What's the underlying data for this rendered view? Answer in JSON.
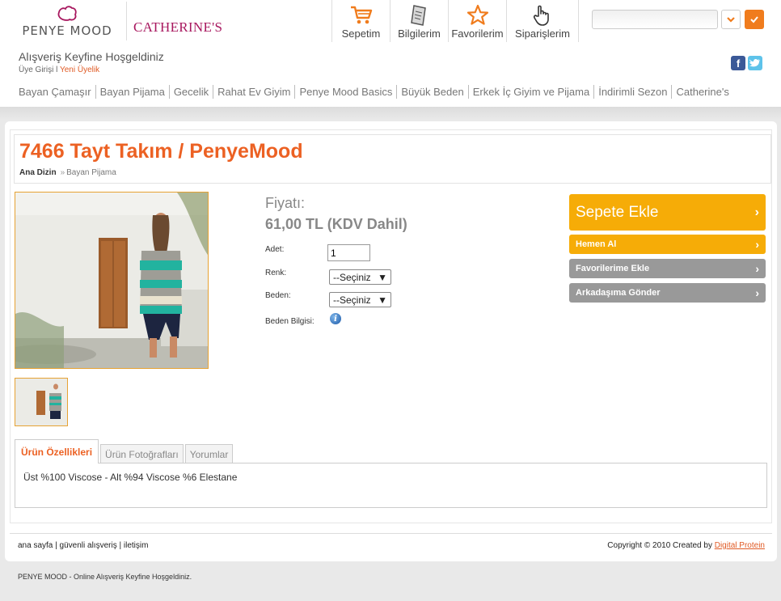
{
  "brand": {
    "primary": "PENYE MOOD",
    "secondary": "CATHERINE'S"
  },
  "topnav": [
    {
      "label": "Sepetim",
      "icon": "cart-icon"
    },
    {
      "label": "Bilgilerim",
      "icon": "document-icon"
    },
    {
      "label": "Favorilerim",
      "icon": "star-icon"
    },
    {
      "label": "Siparişlerim",
      "icon": "hand-pointer-icon"
    }
  ],
  "search": {
    "value": "",
    "placeholder": ""
  },
  "welcome": {
    "message": "Alışveriş Keyfine Hoşgeldiniz",
    "login": "Üye Girişi",
    "separator": "l",
    "register": "Yeni Üyelik"
  },
  "categories": [
    "Bayan Çamaşır",
    "Bayan Pijama",
    "Gecelik",
    "Rahat Ev Giyim",
    "Penye Mood Basics",
    "Büyük Beden",
    "Erkek İç Giyim ve Pijama",
    "İndirimli Sezon",
    "Catherine's"
  ],
  "product": {
    "title": "7466 Tayt Takım / PenyeMood",
    "breadcrumb": {
      "home": "Ana Dizin",
      "arrow": "»",
      "current": "Bayan Pijama"
    },
    "price_label": "Fiyatı:",
    "price_value": "61,00 TL (KDV Dahil)",
    "quantity_label": "Adet:",
    "quantity_value": "1",
    "color_label": "Renk:",
    "color_value": "--Seçiniz",
    "size_label": "Beden:",
    "size_value": "--Seçiniz",
    "size_info_label": "Beden Bilgisi:"
  },
  "actions": {
    "add_to_cart": "Sepete Ekle",
    "buy_now": "Hemen Al",
    "add_favorites": "Favorilerime Ekle",
    "send_friend": "Arkadaşıma Gönder"
  },
  "tabs": [
    {
      "label": "Ürün Özellikleri",
      "active": true
    },
    {
      "label": "Ürün Fotoğrafları",
      "active": false
    },
    {
      "label": "Yorumlar",
      "active": false
    }
  ],
  "tab_content": "Üst %100 Viscose - Alt %94 Viscose %6 Elestane",
  "footer": {
    "link_home": "ana sayfa",
    "link_secure": "güvenli alışveriş",
    "link_contact": "iletişim",
    "sep": "|",
    "copyright": "Copyright © 2010 Created by",
    "creator": "Digital Protein",
    "bottom_note": "PENYE MOOD - Online Alışveriş Keyfine Hoşgeldiniz."
  },
  "colors": {
    "accent": "#ec6123",
    "button_orange": "#f6ac07",
    "button_gray": "#999999",
    "brand_catherines": "#a8185f"
  }
}
